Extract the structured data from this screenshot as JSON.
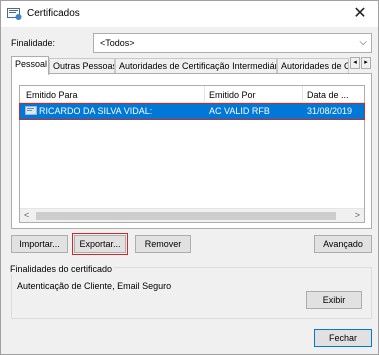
{
  "window": {
    "title": "Certificados",
    "close_glyph": "✕"
  },
  "finalidade": {
    "label": "Finalidade:",
    "selected": "<Todos>"
  },
  "tabs": [
    {
      "label": "Pessoal"
    },
    {
      "label": "Outras Pessoas"
    },
    {
      "label": "Autoridades de Certificação Intermediárias"
    },
    {
      "label": "Autoridades de Ce"
    }
  ],
  "list": {
    "columns": [
      "Emitido Para",
      "Emitido Por",
      "Data de ..."
    ],
    "rows": [
      {
        "issued_to": "RICARDO DA SILVA VIDAL:",
        "issued_by": "AC VALID RFB",
        "date": "31/08/2019"
      }
    ]
  },
  "buttons": {
    "import": "Importar...",
    "export": "Exportar...",
    "remove": "Remover",
    "advanced": "Avançado",
    "view": "Exibir",
    "close": "Fechar"
  },
  "purposes": {
    "title": "Finalidades do certificado",
    "value": "Autenticação de Cliente, Email Seguro"
  },
  "colors": {
    "selection": "#0078d7",
    "highlight": "#cc2a2a"
  },
  "icons": [
    "certificate-icon",
    "close-icon",
    "chevron-down-icon",
    "scroll-left-icon",
    "scroll-right-icon"
  ]
}
